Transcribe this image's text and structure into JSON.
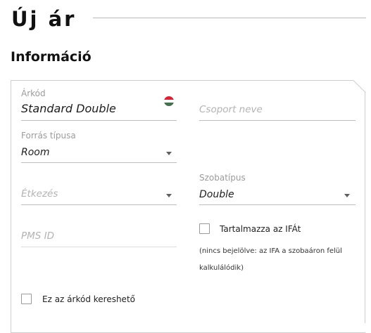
{
  "header": {
    "title": "Új ár"
  },
  "section": {
    "title": "Információ"
  },
  "form": {
    "rate_code": {
      "label": "Árkód",
      "value": "Standard Double",
      "flag_icon": "hungary-flag-icon"
    },
    "group_name": {
      "placeholder": "Csoport neve"
    },
    "source_type": {
      "label": "Forrás típusa",
      "value": "Room"
    },
    "room_type": {
      "label": "Szobatípus",
      "value": "Double"
    },
    "meal": {
      "placeholder": "Étkezés"
    },
    "pms_id": {
      "placeholder": "PMS ID"
    },
    "vat_included": {
      "label": "Tartalmazza az IFÁt",
      "checked": false,
      "note": "(nincs bejelölve: az IFA a szobaáron felül kalkulálódik)"
    },
    "searchable": {
      "label": "Ez az árkód kereshető",
      "checked": false
    }
  },
  "colors": {
    "flag_red": "#ce2939",
    "flag_white": "#ffffff",
    "flag_green": "#477050"
  }
}
